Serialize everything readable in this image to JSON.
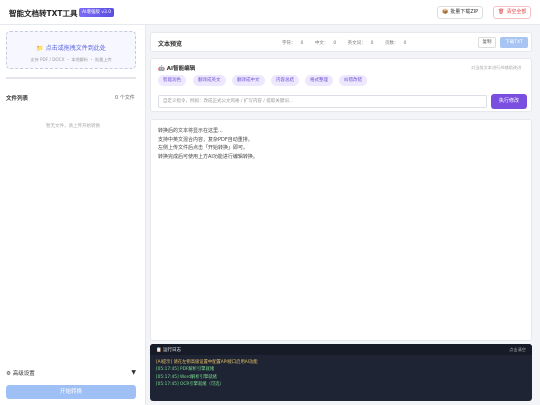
{
  "header": {
    "title": "智能文档转TXT工具",
    "badge": "AI增强版 v3.0",
    "download_zip": {
      "icon": "package-icon",
      "label": "批量下载ZIP"
    },
    "clear_all": {
      "icon": "trash-icon",
      "label": "清空全部"
    }
  },
  "sidebar": {
    "upload": {
      "icon": "folder-icon",
      "title": "点击或拖拽文件到此处",
      "hint": "支持 PDF / DOCX ・ 本地解析 ・ 批量上传"
    },
    "file_list": {
      "title": "文件列表",
      "count": "0 个文件",
      "empty": "暂无文件，请上传开始转换"
    },
    "advanced": {
      "icon": "gear-icon",
      "label": "高级设置",
      "caret": "▼"
    },
    "start_button": "开始转换"
  },
  "preview": {
    "title": "文本预览",
    "stats": [
      {
        "label": "字符：",
        "value": "0"
      },
      {
        "label": "中文：",
        "value": "0"
      },
      {
        "label": "英文词：",
        "value": "0"
      },
      {
        "label": "页数：",
        "value": "0"
      }
    ],
    "copy_label": "复制",
    "download_label": "下载TXT"
  },
  "ai_edit": {
    "icon": "robot-icon",
    "title": "AI智能编辑",
    "hint": "对当前文本进行AI辅助改进",
    "chips": [
      "智能润色",
      "翻译成英文",
      "翻译成中文",
      "内容总结",
      "格式整理",
      "纠错改错"
    ],
    "input_placeholder": "自定义指令，例如：改成正式公文风格 / 扩写内容 / 提取关键词...",
    "exec_label": "执行修改"
  },
  "editor": {
    "lines": [
      "转换后的文本将显示在这里...",
      "支持中英文混合内容，复杂PDF自动重排。",
      "左侧上传文件后点击「开始转换」即可。",
      "转换完成后可使用上方AI功能进行编辑转换。"
    ]
  },
  "log": {
    "title": "运行日志",
    "title_icon": "document-icon",
    "clear_label": "点击清空",
    "lines": [
      {
        "text": "[AI提示] 请在左侧高级设置中配置API接口启用AI功能",
        "kind": "warn"
      },
      {
        "text": "[05:17:45] PDF解析引擎就绪",
        "kind": "ok"
      },
      {
        "text": "[05:17:45] Word解析引擎就绪",
        "kind": "ok"
      },
      {
        "text": "[05:17:45] OCR引擎就绪（可选）",
        "kind": "ok"
      }
    ]
  }
}
